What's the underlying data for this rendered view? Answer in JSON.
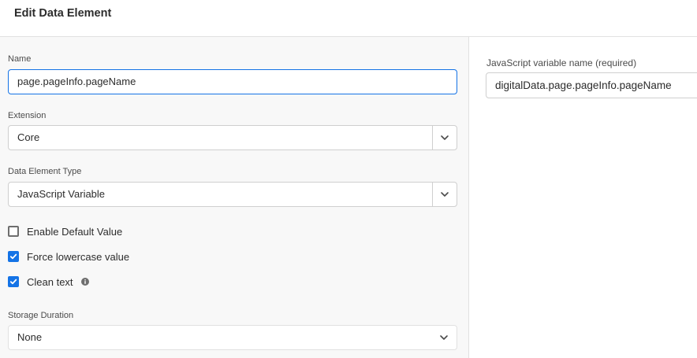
{
  "header": {
    "title": "Edit Data Element"
  },
  "form": {
    "name": {
      "label": "Name",
      "value": "page.pageInfo.pageName"
    },
    "extension": {
      "label": "Extension",
      "value": "Core"
    },
    "data_element_type": {
      "label": "Data Element Type",
      "value": "JavaScript Variable"
    },
    "checkboxes": [
      {
        "label": "Enable Default Value",
        "checked": false
      },
      {
        "label": "Force lowercase value",
        "checked": true
      },
      {
        "label": "Clean text",
        "checked": true
      }
    ],
    "storage_duration": {
      "label": "Storage Duration",
      "value": "None"
    }
  },
  "right_panel": {
    "js_var": {
      "label": "JavaScript variable name (required)",
      "value": "digitalData.page.pageInfo.pageName"
    }
  },
  "colors": {
    "accent": "#1473e6",
    "panel_bg": "#f8f8f8",
    "border": "#cfcfcf"
  },
  "icons": [
    "chevron-down-icon",
    "checkmark-icon",
    "info-icon"
  ]
}
